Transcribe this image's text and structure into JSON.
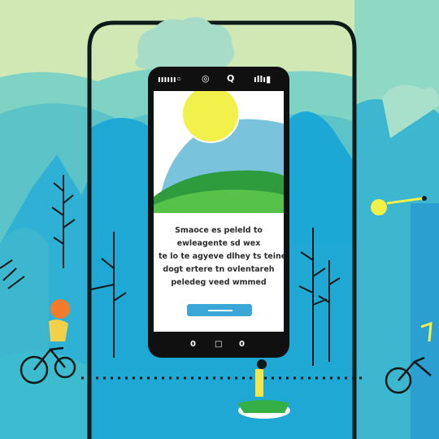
{
  "status_bar": {
    "left_text": "ıııııı◦",
    "mid_icon_1": "◎",
    "mid_icon_2": "Q",
    "right_text": "ıllı▮"
  },
  "screen": {
    "message_lines": [
      "Smaoce es peleld to",
      "ewleagente sd wex",
      "te lo te agyeve dlhey ts teine",
      "dogt ertere tn ovlentareh",
      "peledeg veed wmmed"
    ],
    "button_icon": "horizontal-bar-icon"
  },
  "nav_bar": {
    "back": "0",
    "home": "□",
    "recent": "0"
  },
  "colors": {
    "sky": "#cfe8b4",
    "forest_teal": "#4cc0c8",
    "forest_blue": "#1ca8d4",
    "sun": "#f2f04a",
    "hill_green": "#2e9c3c",
    "accent_button": "#3aa7d6"
  }
}
